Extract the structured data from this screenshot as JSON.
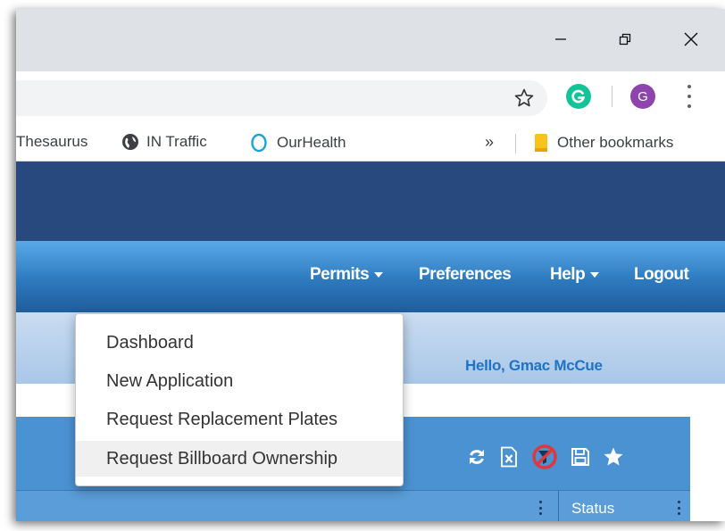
{
  "browser": {
    "bookmarks": [
      {
        "label": "Thesaurus",
        "icon": "none"
      },
      {
        "label": "IN Traffic",
        "icon": "globe-icon"
      },
      {
        "label": "OurHealth",
        "icon": "ring-icon"
      }
    ],
    "overflow_label": "»",
    "other_bookmarks_label": "Other bookmarks",
    "avatar_letter": "G",
    "colors": {
      "grammarly": "#15c39a",
      "avatar": "#8e44ad",
      "folder": "#f8c31a"
    }
  },
  "site": {
    "nav": {
      "permits_label": "Permits",
      "preferences_label": "Preferences",
      "help_label": "Help",
      "logout_label": "Logout"
    },
    "greeting": "Hello, Gmac McCue",
    "table": {
      "status_header": "Status"
    },
    "toolbar_icons": [
      "refresh-icon",
      "excel-export-icon",
      "clear-filter-icon",
      "save-icon",
      "favorite-star-icon"
    ],
    "colors": {
      "banner": "#28497d",
      "nav_top": "#5aaae8",
      "nav_bottom": "#1f5d9b",
      "panel": "#4b92d2",
      "greeting": "#1f73c7",
      "clear_filter": "#e0383a"
    }
  },
  "permits_menu": {
    "items": [
      {
        "label": "Dashboard"
      },
      {
        "label": "New Application"
      },
      {
        "label": "Request Replacement Plates"
      },
      {
        "label": "Request Billboard Ownership",
        "hovered": true
      }
    ]
  }
}
